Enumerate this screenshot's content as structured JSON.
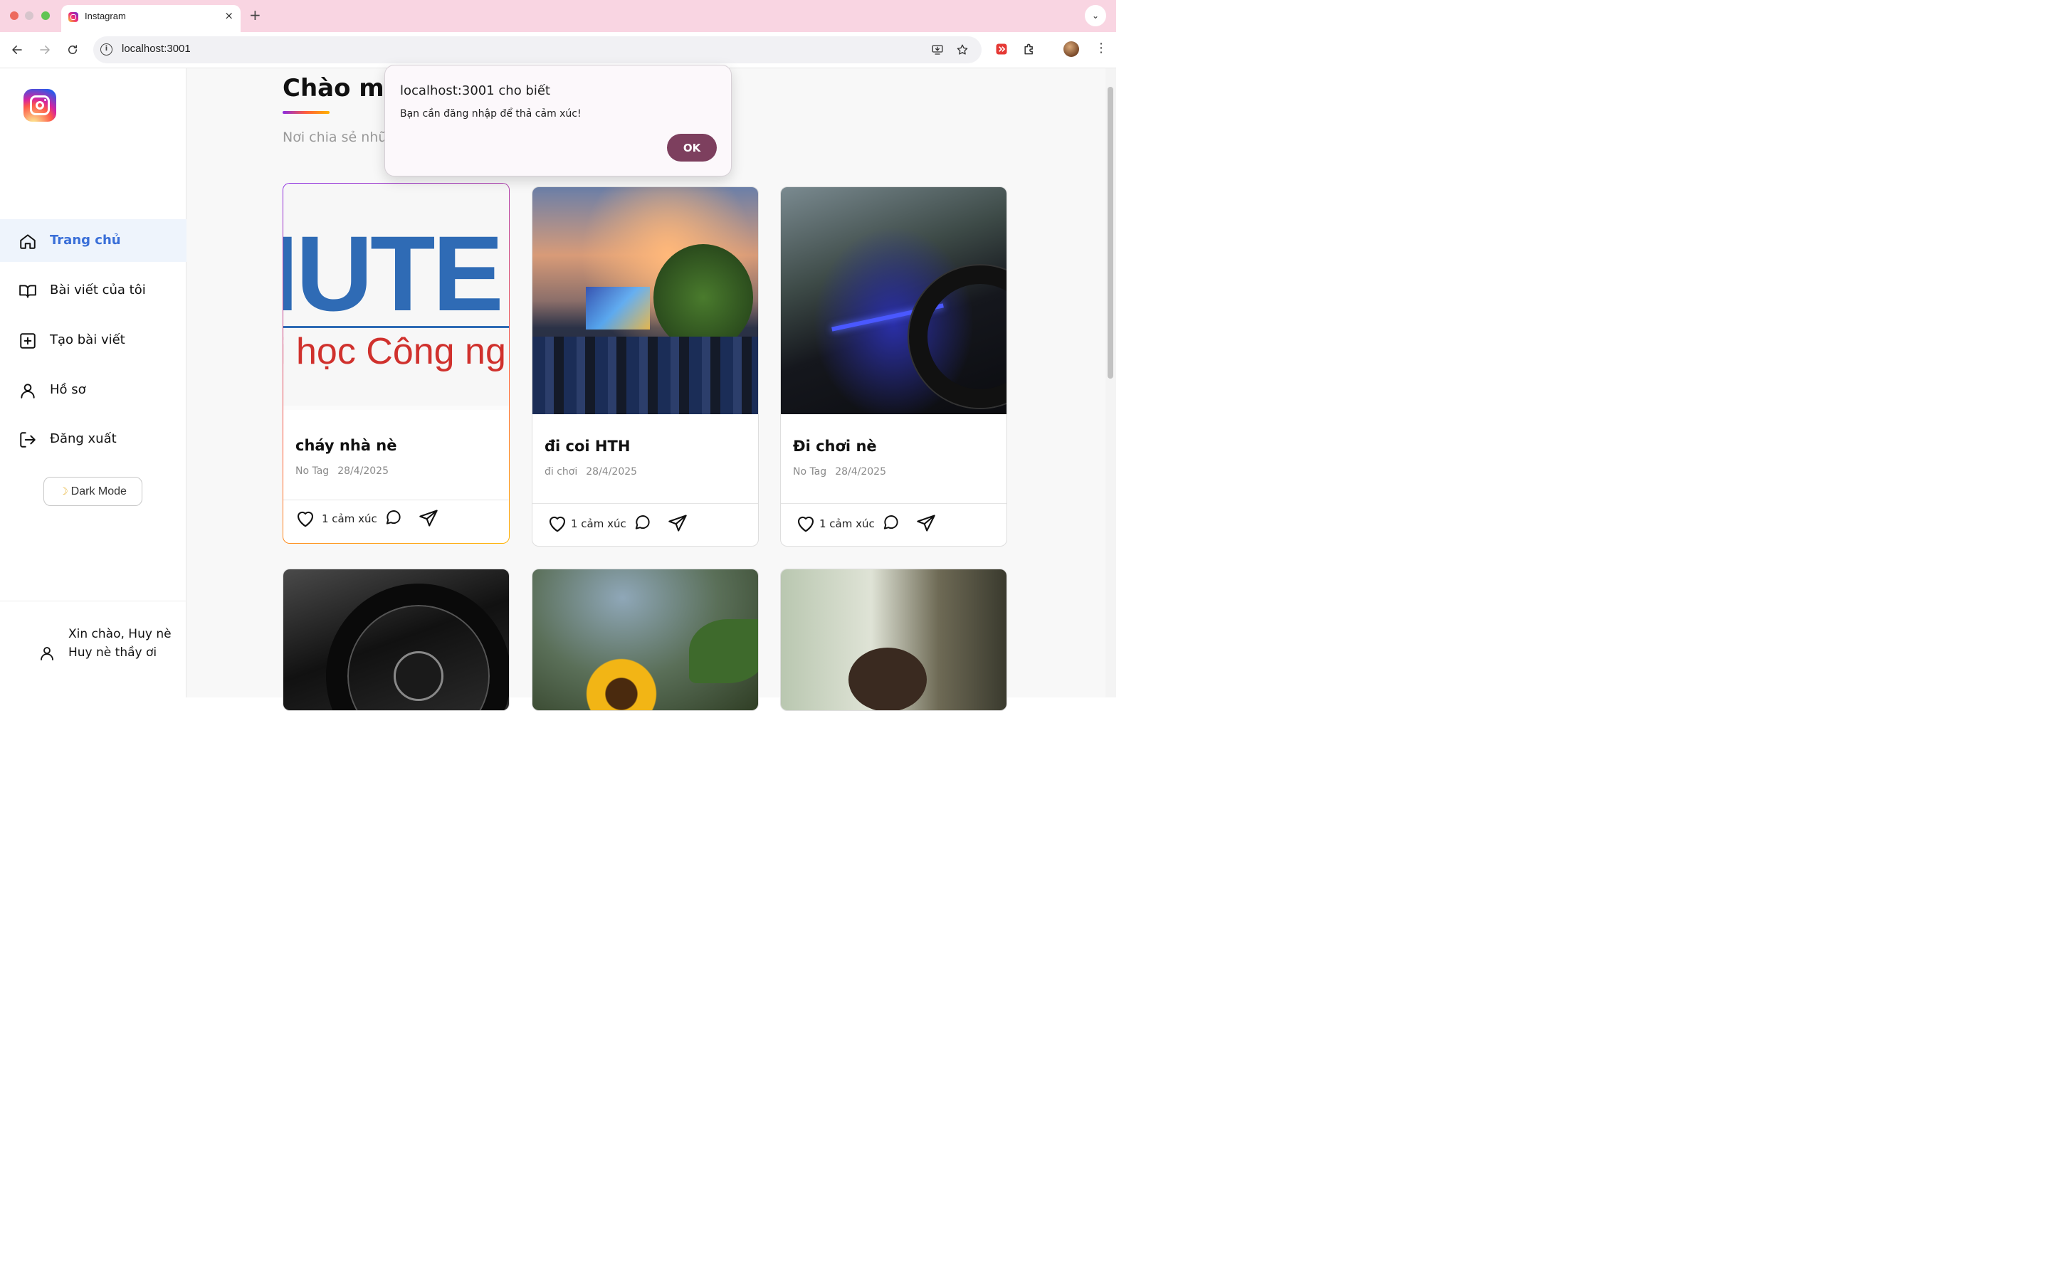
{
  "browser": {
    "tab_title": "Instagram",
    "tab_close": "×",
    "new_tab": "+",
    "url": "localhost:3001",
    "menu_dots": "⋮",
    "tab_menu": "⌄"
  },
  "sidebar": {
    "items": [
      {
        "label": "Trang chủ",
        "icon": "home-icon",
        "active": true
      },
      {
        "label": "Bài viết của tôi",
        "icon": "book-icon"
      },
      {
        "label": "Tạo bài viết",
        "icon": "plus-square-icon"
      },
      {
        "label": "Hồ sơ",
        "icon": "user-icon"
      },
      {
        "label": "Đăng xuất",
        "icon": "logout-icon"
      }
    ],
    "dark_mode_label": "Dark Mode",
    "greeting": "Xin chào, Huy nè Huy nè thầy ơi"
  },
  "main": {
    "title": "Chào mừ",
    "subtitle": "Nơi chia sẻ nhữ"
  },
  "posts": [
    {
      "title": "cháy nhà nè",
      "tag": "No Tag",
      "date": "28/4/2025",
      "reactions": "1 cảm xúc",
      "image_text_big": "IUTE",
      "image_text_sub": "i học Công ng"
    },
    {
      "title": "đi coi HTH",
      "tag": "đi chơi",
      "date": "28/4/2025",
      "reactions": "1 cảm xúc"
    },
    {
      "title": "Đi chơi nè",
      "tag": "No Tag",
      "date": "28/4/2025",
      "reactions": "1 cảm xúc"
    }
  ],
  "dialog": {
    "title": "localhost:3001 cho biết",
    "message": "Bạn cần đăng nhập để thả cảm xúc!",
    "ok_label": "OK"
  },
  "colors": {
    "active_nav": "#3a6fd8",
    "active_nav_bg": "#eef4fc",
    "dialog_button": "#7d3f5e",
    "tabbar": "#f9d5e2"
  }
}
